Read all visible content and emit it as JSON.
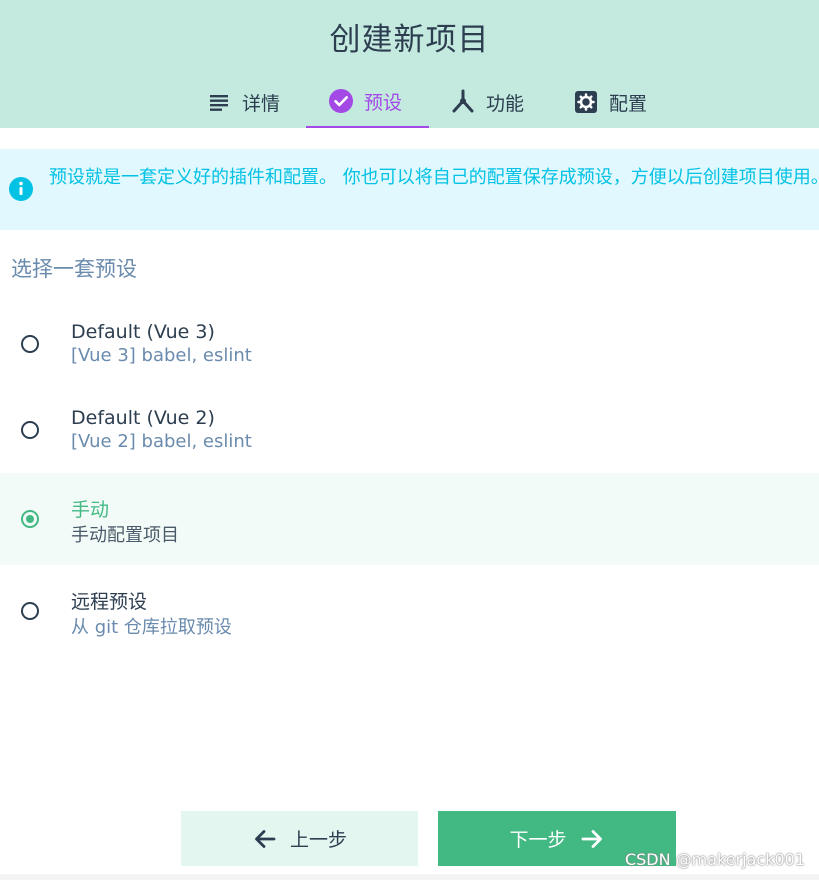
{
  "header": {
    "title": "创建新项目"
  },
  "tabs": [
    {
      "label": "详情",
      "icon": "subject-icon",
      "active": false
    },
    {
      "label": "预设",
      "icon": "check-circle-icon",
      "active": true
    },
    {
      "label": "功能",
      "icon": "call-split-icon",
      "active": false
    },
    {
      "label": "配置",
      "icon": "settings-box-icon",
      "active": false
    }
  ],
  "info": {
    "text": "预设就是一套定义好的插件和配置。 你也可以将自己的配置保存成预设，方便以后创建项目使用。",
    "icon": "info-icon"
  },
  "presets": {
    "title": "选择一套预设",
    "options": [
      {
        "name": "Default (Vue 3)",
        "description": "[Vue 3] babel, eslint",
        "selected": false
      },
      {
        "name": "Default (Vue 2)",
        "description": "[Vue 2] babel, eslint",
        "selected": false
      },
      {
        "name": "手动",
        "description": "手动配置项目",
        "selected": true
      },
      {
        "name": "远程预设",
        "description": "从 git 仓库拉取预设",
        "selected": false
      }
    ]
  },
  "footer": {
    "prev_label": "上一步",
    "next_label": "下一步"
  },
  "watermark": "CSDN @makerjack001",
  "colors": {
    "header_bg": "#c4eadf",
    "accent_purple": "#a249e6",
    "accent_green": "#42b983",
    "info_text": "#03c2e4",
    "info_bg": "#e1f8fe"
  }
}
